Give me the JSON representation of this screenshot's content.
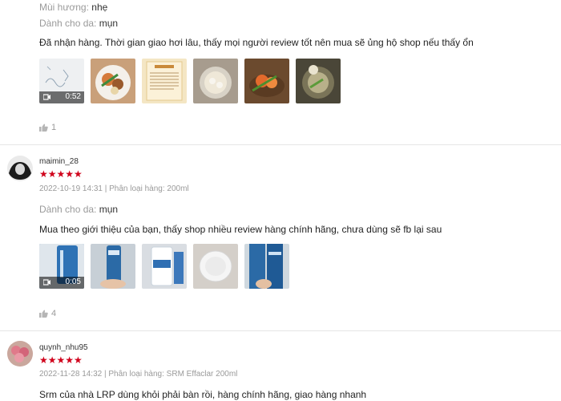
{
  "review1": {
    "attr_scent_key": "Mùi hương:",
    "attr_scent_val": "nhẹ",
    "attr_skin_key": "Dành cho da:",
    "attr_skin_val": "mụn",
    "comment": "Đã nhận hàng. Thời gian giao hơi lâu, thấy mọi người review tốt nên mua sẽ ủng hộ shop nếu thấy ổn",
    "video_duration": "0:52",
    "likes": "1"
  },
  "review2": {
    "username": "maimin_28",
    "stars": "★★★★★",
    "rating": 5,
    "date": "2022-10-19 14:31",
    "separator": "|",
    "variant": "Phân loại hàng: 200ml",
    "attr_skin_key": "Dành cho da:",
    "attr_skin_val": "mụn",
    "comment": "Mua theo giới thiệu của bạn, thấy shop nhiều review hàng chính hãng, chưa dùng sẽ fb lại sau",
    "video_duration": "0:05",
    "likes": "4"
  },
  "review3": {
    "username": "quynh_nhu95",
    "stars": "★★★★★",
    "rating": 5,
    "date": "2022-11-28 14:32",
    "separator": "|",
    "variant": "Phân loại hàng: SRM Effaclar 200ml",
    "comment": "Srm của nhà LRP dùng khỏi phải bàn rồi, hàng chính hãng, giao hàng nhanh"
  },
  "colors": {
    "star": "#d0011b",
    "muted": "#9a9a9a",
    "divider": "#e6e6e6"
  },
  "icons": {
    "like": "thumbs-up-icon",
    "video": "video-camera-icon"
  }
}
